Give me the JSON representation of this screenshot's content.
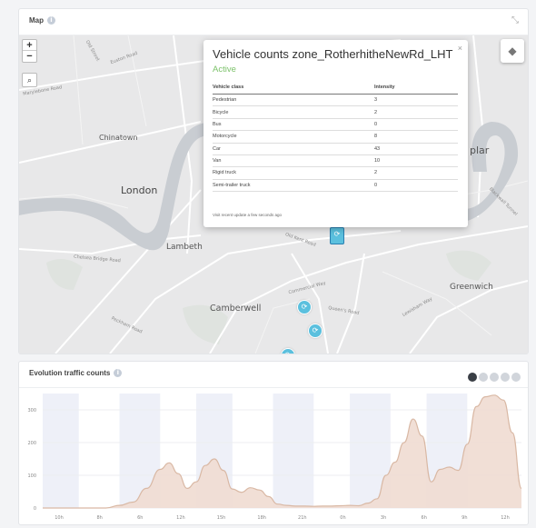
{
  "map_card": {
    "title": "Map",
    "info_icon": "i",
    "expand_icon": "⤡",
    "zoom_in": "+",
    "zoom_out": "−",
    "search_icon": "⌕",
    "layers_icon": "◆",
    "places": {
      "chinatown": "Chinatown",
      "london": "London",
      "lambeth": "Lambeth",
      "camberwell": "Camberwell",
      "greenwich": "Greenwich",
      "poplar": "plar"
    },
    "streets": {
      "euston": "Euston Road",
      "marylebone": "Marylebone Road",
      "oldstreet": "Old Street",
      "kent": "Old Kent Road",
      "queens": "Queen's Road",
      "commercial": "Commercial Way",
      "peckham": "Peckham Road",
      "lewisham": "Lewisham Way",
      "blackwall": "Blackwall Tunnel",
      "chelsea": "Chelsea Bridge Road"
    }
  },
  "popup": {
    "title": "Vehicle counts zone_RotherhitheNewRd_LHT",
    "status": "Active",
    "close": "×",
    "header_class": "Vehicle class",
    "header_intensity": "Intensity",
    "rows": [
      {
        "label": "Pedestrian",
        "value": "3"
      },
      {
        "label": "Bicycle",
        "value": "2"
      },
      {
        "label": "Bus",
        "value": "0"
      },
      {
        "label": "Motorcycle",
        "value": "8"
      },
      {
        "label": "Car",
        "value": "43"
      },
      {
        "label": "Van",
        "value": "10"
      },
      {
        "label": "Rigid truck",
        "value": "2"
      },
      {
        "label": "Semi-trailer truck",
        "value": "0"
      }
    ],
    "footer": "Visit recent update a few seconds ago"
  },
  "chart_card": {
    "title": "Evolution traffic counts",
    "info_icon": "i",
    "tools": [
      "download-icon",
      "zoom-icon",
      "pan-icon",
      "home-icon",
      "menu-icon"
    ]
  },
  "chart_data": {
    "type": "area",
    "ylim": [
      0,
      350
    ],
    "yticks": [
      0,
      100,
      200,
      300
    ],
    "x_tick_labels": [
      "10h",
      "8h",
      "6h",
      "12h",
      "15h",
      "18h",
      "21h",
      "0h",
      "3h",
      "6h",
      "9h",
      "12h"
    ],
    "series_color": "#d9b8a4",
    "series_fill": "#efdcd1",
    "band_color": "#eef0f8",
    "x": [
      0,
      40,
      70,
      85,
      100,
      115,
      130,
      140,
      150,
      160,
      170,
      180,
      190,
      200,
      210,
      220,
      230,
      240,
      250,
      260,
      270,
      280,
      290,
      300,
      310,
      320,
      330,
      340,
      350,
      360,
      370,
      380,
      390,
      400,
      410,
      420,
      430,
      440,
      450,
      460,
      470,
      480,
      490,
      500,
      510,
      520,
      530
    ],
    "y": [
      0,
      0,
      0,
      8,
      18,
      60,
      118,
      138,
      105,
      60,
      80,
      130,
      150,
      115,
      58,
      48,
      62,
      55,
      35,
      12,
      8,
      6,
      6,
      5,
      6,
      6,
      7,
      8,
      7,
      15,
      28,
      100,
      140,
      200,
      272,
      220,
      80,
      118,
      125,
      115,
      195,
      310,
      340,
      345,
      330,
      230,
      60
    ]
  }
}
